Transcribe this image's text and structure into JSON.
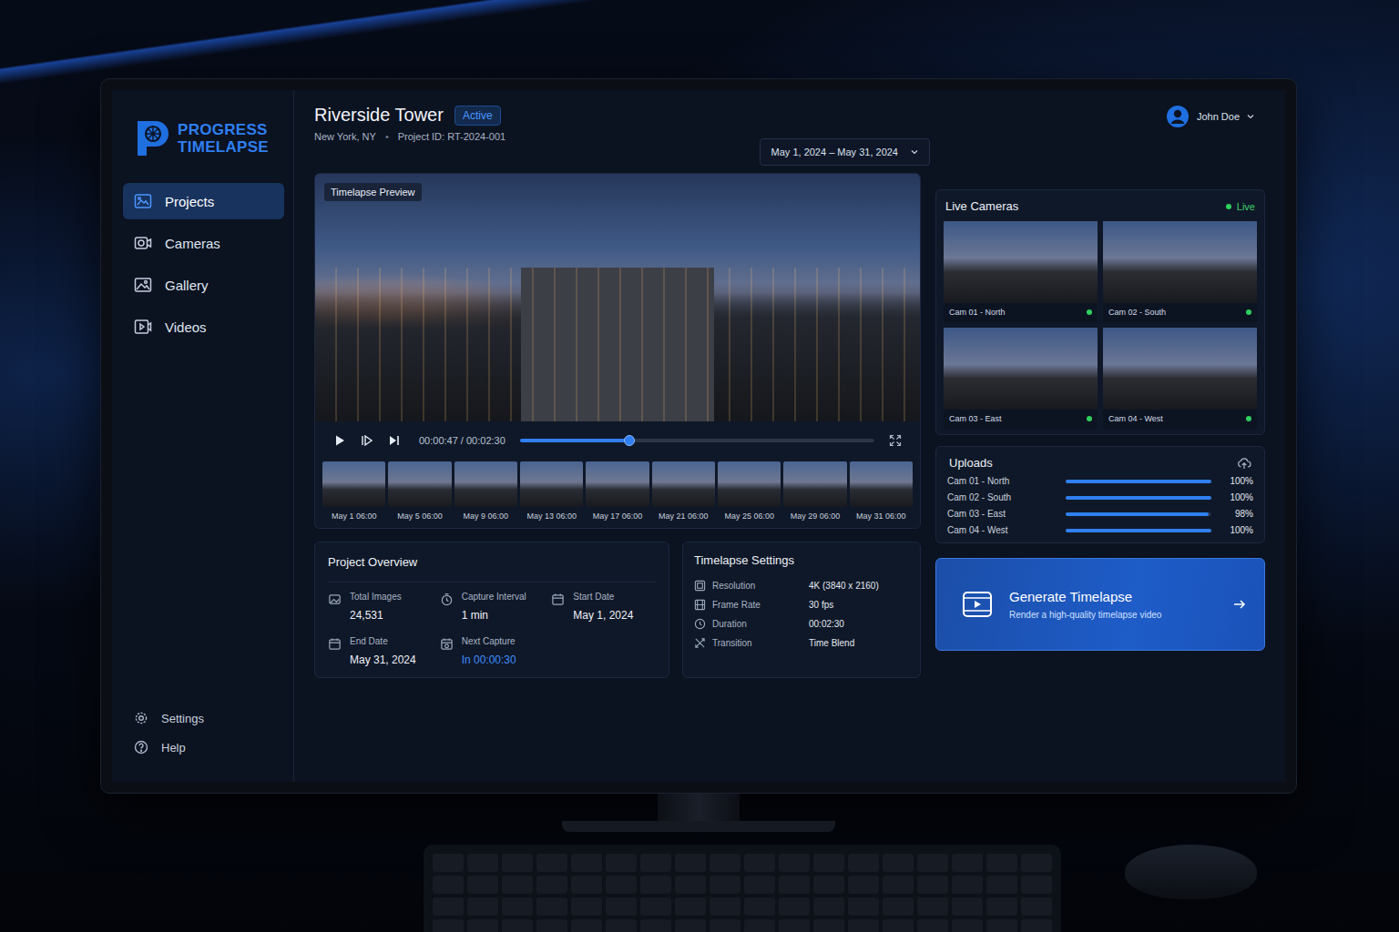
{
  "brand": {
    "top": "PROGRESS",
    "bottom": "TIMELAPSE"
  },
  "sidebar": {
    "items": [
      {
        "label": "Projects",
        "selected": true
      },
      {
        "label": "Cameras",
        "selected": false
      },
      {
        "label": "Gallery",
        "selected": false
      },
      {
        "label": "Videos",
        "selected": false
      }
    ],
    "footer_items": [
      {
        "label": "Settings"
      },
      {
        "label": "Help"
      }
    ]
  },
  "user": {
    "name": "John Doe"
  },
  "project": {
    "title": "Riverside Tower",
    "status": "Active",
    "location": "New York, NY",
    "separator": "•",
    "id": "Project ID: RT-2024-001"
  },
  "date_range": "May 1, 2024 – May 31, 2024",
  "preview": {
    "label": "Timelapse Preview",
    "time": "00:00:47 / 00:02:30",
    "level": 0.31
  },
  "frames": [
    "May 1 06:00",
    "May 5 06:00",
    "May 9 06:00",
    "May 13 06:00",
    "May 17 06:00",
    "May 21 06:00",
    "May 25 06:00",
    "May 29 06:00",
    "May 31 06:00"
  ],
  "overview": {
    "title": "Project Overview",
    "items": [
      {
        "label": "Total Images",
        "value": "24,531",
        "accent": false
      },
      {
        "label": "Capture Interval",
        "value": "1 min",
        "accent": false
      },
      {
        "label": "Start Date",
        "value": "May 1, 2024",
        "accent": false
      },
      {
        "label": "End Date",
        "value": "May 31, 2024",
        "accent": false
      },
      {
        "label": "Next Capture",
        "value": "In 00:00:30",
        "accent": true
      }
    ]
  },
  "settings": {
    "title": "Timelapse Settings",
    "rows": [
      {
        "label": "Resolution",
        "value": "4K (3840 x 2160)"
      },
      {
        "label": "Frame Rate",
        "value": "30 fps"
      },
      {
        "label": "Duration",
        "value": "00:02:30"
      },
      {
        "label": "Transition",
        "value": "Time Blend"
      }
    ]
  },
  "live": {
    "title": "Live Cameras",
    "status": "Live",
    "cameras": [
      {
        "name": "Cam 01 - North",
        "online": true
      },
      {
        "name": "Cam 02 - South",
        "online": true
      },
      {
        "name": "Cam 03 - East",
        "online": true
      },
      {
        "name": "Cam 04 - West",
        "online": true
      }
    ]
  },
  "uploads": {
    "title": "Uploads",
    "rows": [
      {
        "name": "Cam 01 - North",
        "level": 1.0,
        "reading": "100%"
      },
      {
        "name": "Cam 02 - South",
        "level": 1.0,
        "reading": "100%"
      },
      {
        "name": "Cam 03 - East",
        "level": 0.98,
        "reading": "98%"
      },
      {
        "name": "Cam 04 - West",
        "level": 1.0,
        "reading": "100%"
      }
    ]
  },
  "generate": {
    "title": "Generate Timelapse",
    "subtitle": "Render a high-quality timelapse video"
  }
}
